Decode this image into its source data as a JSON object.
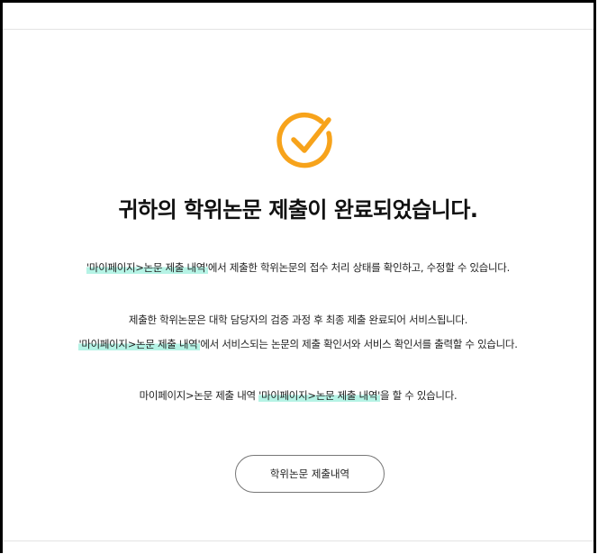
{
  "icon": {
    "name": "check-circle-icon",
    "color": "#f7a31b"
  },
  "title": "귀하의 학위논문 제출이 완료되었습니다.",
  "para1": {
    "highlight": "'마이페이지>논문 제출 내역'",
    "text": "에서 제출한 학위논문의 접수 처리 상태를 확인하고, 수정할 수 있습니다."
  },
  "para2": {
    "line1": "제출한 학위논문은 대학 담당자의 검증 과정 후 최종 제출 완료되어 서비스됩니다.",
    "highlight": "'마이페이지>논문 제출 내역'",
    "text": "에서 서비스되는 논문의 제출 확인서와 서비스 확인서를 출력할 수 있습니다."
  },
  "para3": {
    "prefix": "마이페이지>논문 제출 내역 ",
    "highlight": "'마이페이지>논문 제출 내역'",
    "suffix": "을 할 수 있습니다."
  },
  "button": {
    "label": "학위논문 제출내역"
  },
  "colors": {
    "accent": "#f7a31b",
    "highlight": "#b5f3e5"
  }
}
